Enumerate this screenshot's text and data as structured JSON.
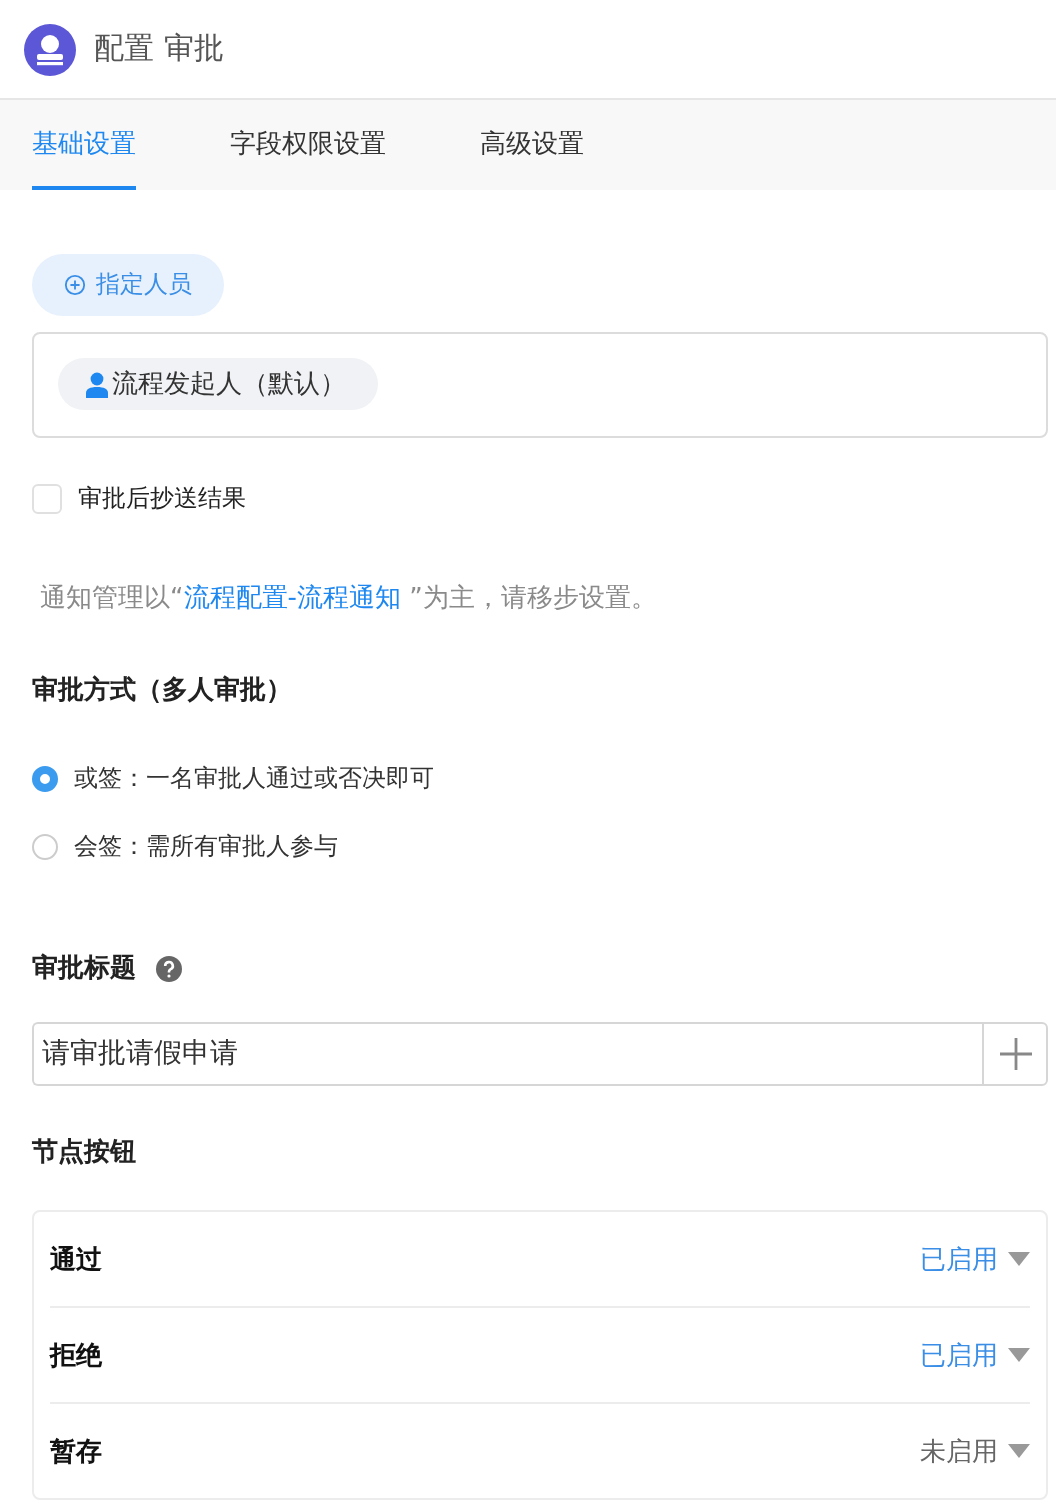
{
  "header": {
    "title": "配置 审批"
  },
  "tabs": [
    {
      "label": "基础设置",
      "selected": true
    },
    {
      "label": "字段权限设置",
      "selected": false
    },
    {
      "label": "高级设置",
      "selected": false
    }
  ],
  "assign_button": {
    "label": "指定人员"
  },
  "assignees": [
    {
      "label": "流程发起人（默认）"
    }
  ],
  "cc_option": {
    "label": "审批后抄送结果",
    "checked": false
  },
  "notice": {
    "before": "通知管理以“",
    "link": "流程配置-流程通知",
    "after": " ”为主，请移步设置。"
  },
  "approval_mode": {
    "title": "审批方式（多人审批）",
    "options": [
      {
        "label": "或签：一名审批人通过或否决即可",
        "selected": true
      },
      {
        "label": "会签：需所有审批人参与",
        "selected": false
      }
    ]
  },
  "approval_title": {
    "label": "审批标题",
    "value": "请审批请假申请"
  },
  "node_buttons": {
    "title": "节点按钮",
    "items": [
      {
        "label": "通过",
        "status": "已启用",
        "enabled": true
      },
      {
        "label": "拒绝",
        "status": "已启用",
        "enabled": true
      },
      {
        "label": "暂存",
        "status": "未启用",
        "enabled": false
      }
    ]
  }
}
